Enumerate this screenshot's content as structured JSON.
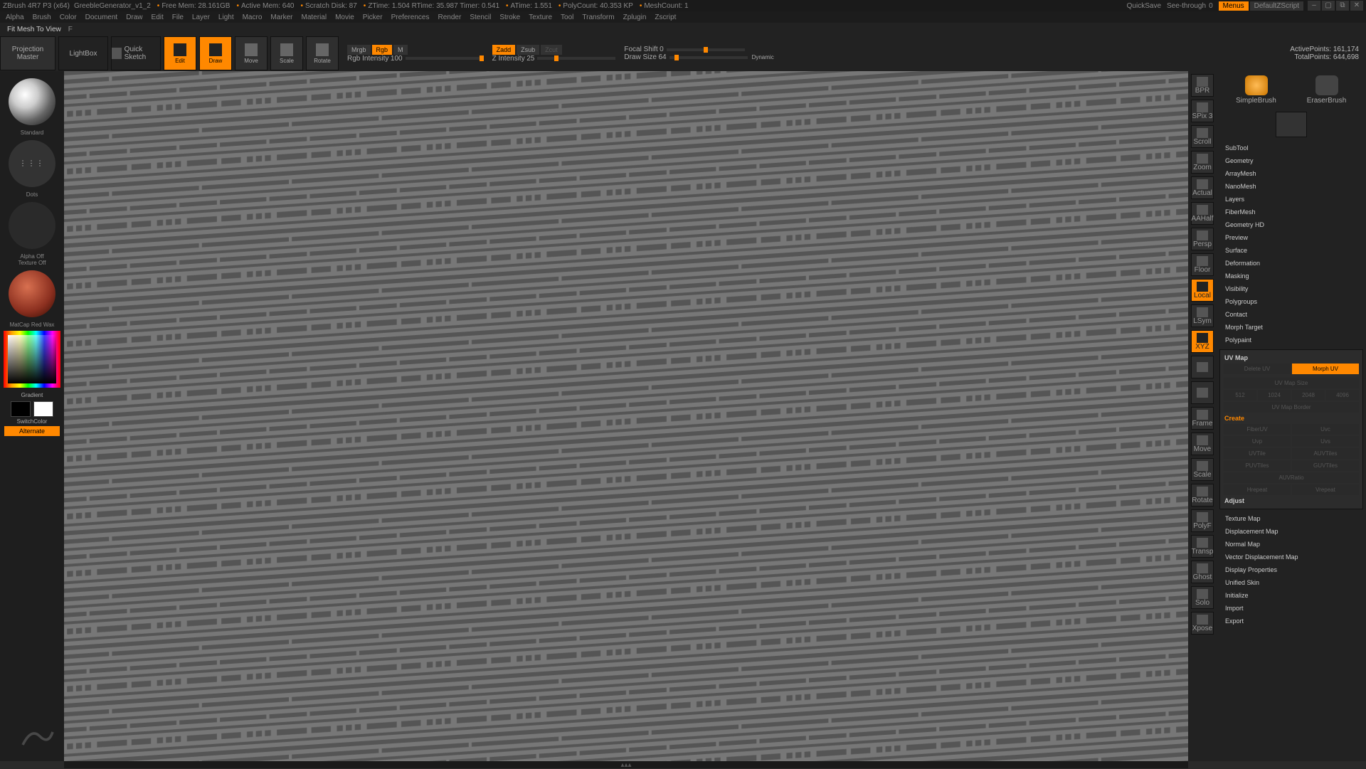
{
  "titlebar": {
    "app": "ZBrush 4R7 P3 (x64)",
    "doc": "GreebleGenerator_v1_2",
    "stats": [
      "Free Mem: 28.161GB",
      "Active Mem: 640",
      "Scratch Disk: 87",
      "ZTime: 1.504  RTime: 35.987  Timer: 0.541",
      "ATime: 1.551",
      "PolyCount: 40.353 KP",
      "MeshCount: 1"
    ],
    "quicksave": "QuickSave",
    "seethrough_label": "See-through",
    "seethrough_value": "0",
    "menus": "Menus",
    "script": "DefaultZScript"
  },
  "menubar": [
    "Alpha",
    "Brush",
    "Color",
    "Document",
    "Draw",
    "Edit",
    "File",
    "Layer",
    "Light",
    "Macro",
    "Marker",
    "Material",
    "Movie",
    "Picker",
    "Preferences",
    "Render",
    "Stencil",
    "Stroke",
    "Texture",
    "Tool",
    "Transform",
    "Zplugin",
    "Zscript"
  ],
  "hint": {
    "text": "Fit Mesh To View",
    "shortcut": "F"
  },
  "toolbar": {
    "projection": "Projection\nMaster",
    "lightbox": "LightBox",
    "quicksketch": "Quick Sketch",
    "modes": [
      "Edit",
      "Draw",
      "Move",
      "Scale",
      "Rotate"
    ],
    "mrgb": "Mrgb",
    "rgb": "Rgb",
    "m": "M",
    "rgb_intensity_label": "Rgb Intensity",
    "rgb_intensity_val": "100",
    "zadd": "Zadd",
    "zsub": "Zsub",
    "zcut": "Zcut",
    "zintensity_label": "Z Intensity",
    "zintensity_val": "25",
    "focal_label": "Focal Shift",
    "focal_val": "0",
    "drawsize_label": "Draw Size",
    "drawsize_val": "64",
    "dynamic": "Dynamic",
    "active_pts_label": "ActivePoints:",
    "active_pts": "161,174",
    "total_pts_label": "TotalPoints:",
    "total_pts": "644,698"
  },
  "left": {
    "brush": "Standard",
    "stroke": "Dots",
    "alpha": "Alpha Off",
    "texture": "Texture Off",
    "material": "MatCap Red Wax",
    "gradient": "Gradient",
    "switchcolor": "SwitchColor",
    "alternate": "Alternate"
  },
  "rtray": {
    "items": [
      "BPR",
      "SPix 3",
      "Scroll",
      "Zoom",
      "Actual",
      "AAHalf",
      "Persp",
      "Floor",
      "Local",
      "LSym",
      "XYZ",
      "",
      "",
      "Frame",
      "Move",
      "Scale",
      "Rotate",
      "PolyF",
      "Transp",
      "Ghost",
      "Solo",
      "Xpose"
    ],
    "active": [
      8,
      10
    ]
  },
  "rpanel": {
    "brushes": [
      "SimpleBrush",
      "EraserBrush"
    ],
    "list": [
      "SubTool",
      "Geometry",
      "ArrayMesh",
      "NanoMesh",
      "Layers",
      "FiberMesh",
      "Geometry HD",
      "Preview",
      "Surface",
      "Deformation",
      "Masking",
      "Visibility",
      "Polygroups",
      "Contact",
      "Morph Target",
      "Polypaint"
    ],
    "uv_header": "UV Map",
    "delete_uv": "Delete UV",
    "morph_uv": "Morph UV",
    "uv_size_label": "UV Map Size",
    "uv_sizes": [
      "512",
      "1024",
      "2048",
      "4096"
    ],
    "uv_border_label": "UV Map Border",
    "create_header": "Create",
    "create_items": [
      [
        "FiberUV",
        "Uvc"
      ],
      [
        "Uvp",
        "Uvs"
      ],
      [
        "UVTile",
        "AUVTiles"
      ],
      [
        "PUVTiles",
        "GUVTiles"
      ]
    ],
    "auvratio": "AUVRatio",
    "hrepeat": "Hrepeat",
    "vrepeat": "Vrepeat",
    "adjust_header": "Adjust",
    "list2": [
      "Texture Map",
      "Displacement Map",
      "Normal Map",
      "Vector Displacement Map",
      "Display Properties",
      "Unified Skin",
      "Initialize",
      "Import",
      "Export"
    ]
  }
}
